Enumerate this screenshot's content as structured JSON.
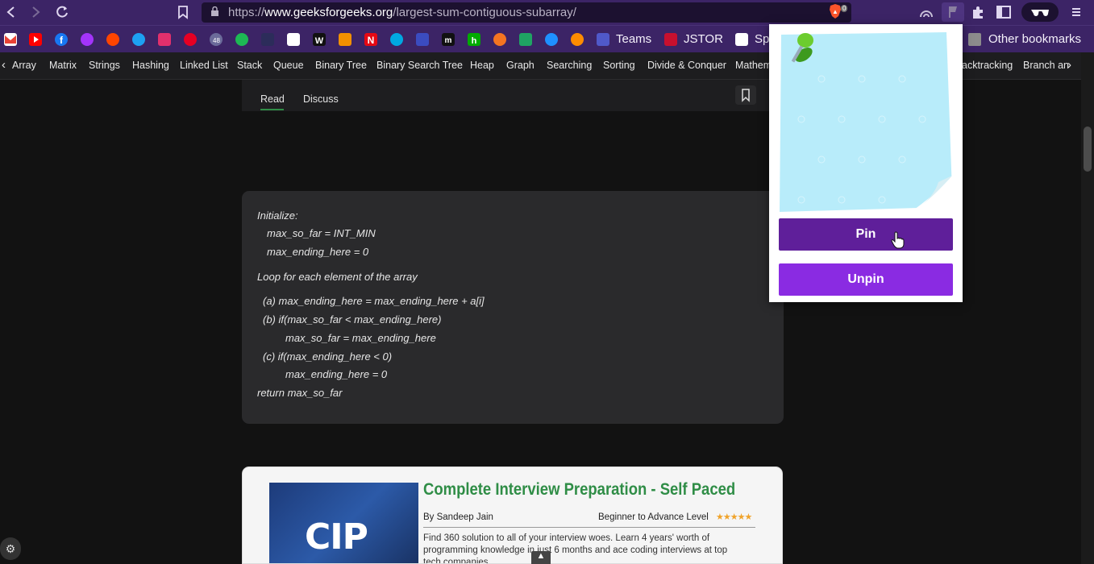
{
  "browser": {
    "url_scheme": "https://",
    "url_domain": "www.geeksforgeeks.org",
    "url_path": "/largest-sum-contiguous-subarray/",
    "badge_count": "0"
  },
  "bookmarks": {
    "badge_count": "48",
    "teams": "Teams",
    "jstor": "JSTOR",
    "partial": "Sp",
    "other": "Other bookmarks"
  },
  "topics": [
    "Array",
    "Matrix",
    "Strings",
    "Hashing",
    "Linked List",
    "Stack",
    "Queue",
    "Binary Tree",
    "Binary Search Tree",
    "Heap",
    "Graph",
    "Searching",
    "Sorting",
    "Divide & Conquer",
    "Mathem",
    "acktracking",
    "Branch an"
  ],
  "tabs": {
    "read": "Read",
    "discuss": "Discuss"
  },
  "code": [
    "Initialize:",
    "max_so_far = INT_MIN",
    "max_ending_here = 0",
    "Loop for each element of the array",
    "(a) max_ending_here = max_ending_here + a[i]",
    "(b) if(max_so_far < max_ending_here)",
    "max_so_far = max_ending_here",
    "(c) if(max_ending_here < 0)",
    "max_ending_here = 0",
    "return max_so_far"
  ],
  "ad": {
    "image_text": "CIP",
    "title": "Complete Interview Preparation - Self Paced",
    "author": "By Sandeep Jain",
    "level": "Beginner to Advance Level",
    "stars": "★★★★★",
    "description": "Find 360 solution to all of your interview woes. Learn 4 years' worth of programming knowledge in just 6 months and ace coding interviews at top tech companies."
  },
  "popup": {
    "pin": "Pin",
    "unpin": "Unpin"
  },
  "colors": {
    "pin": "#5f1f9a",
    "unpin": "#8a2be2",
    "chrome": "#3c2466",
    "accent": "#2f8d46"
  }
}
